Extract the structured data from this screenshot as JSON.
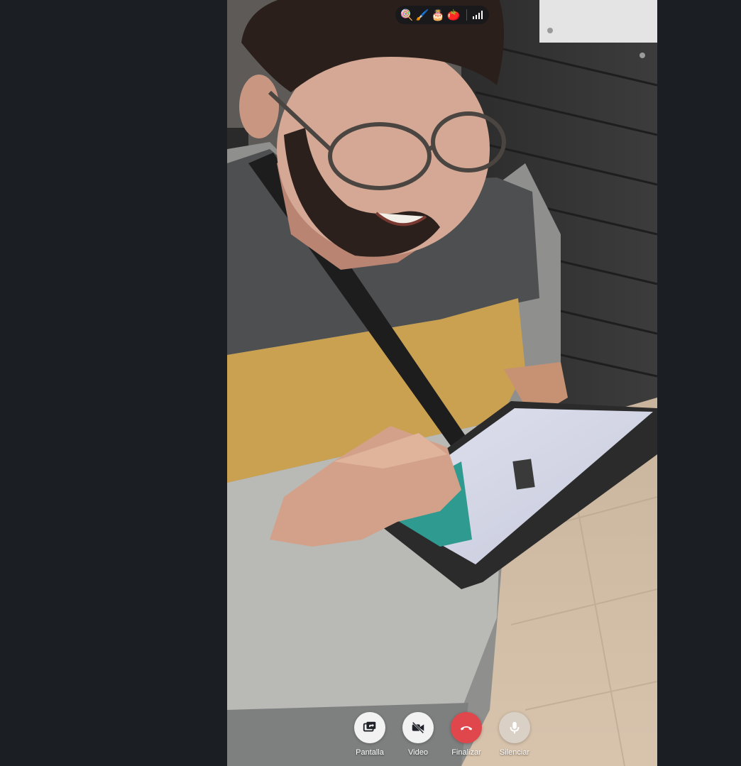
{
  "status_bar": {
    "encryption_emojis": [
      "🍭",
      "🖌️",
      "🎂",
      "🍅"
    ],
    "signal_icon": "signal-bars-icon"
  },
  "controls": [
    {
      "id": "screen",
      "label": "Pantalla",
      "icon": "screen-share-icon"
    },
    {
      "id": "video",
      "label": "Video",
      "icon": "video-off-icon"
    },
    {
      "id": "end",
      "label": "Finalizar",
      "icon": "hang-up-icon"
    },
    {
      "id": "mute",
      "label": "Silenciar",
      "icon": "microphone-icon"
    }
  ],
  "colors": {
    "background": "#1b1f24",
    "end_call": "#e0474c",
    "control_light": "#f2f2f2"
  }
}
